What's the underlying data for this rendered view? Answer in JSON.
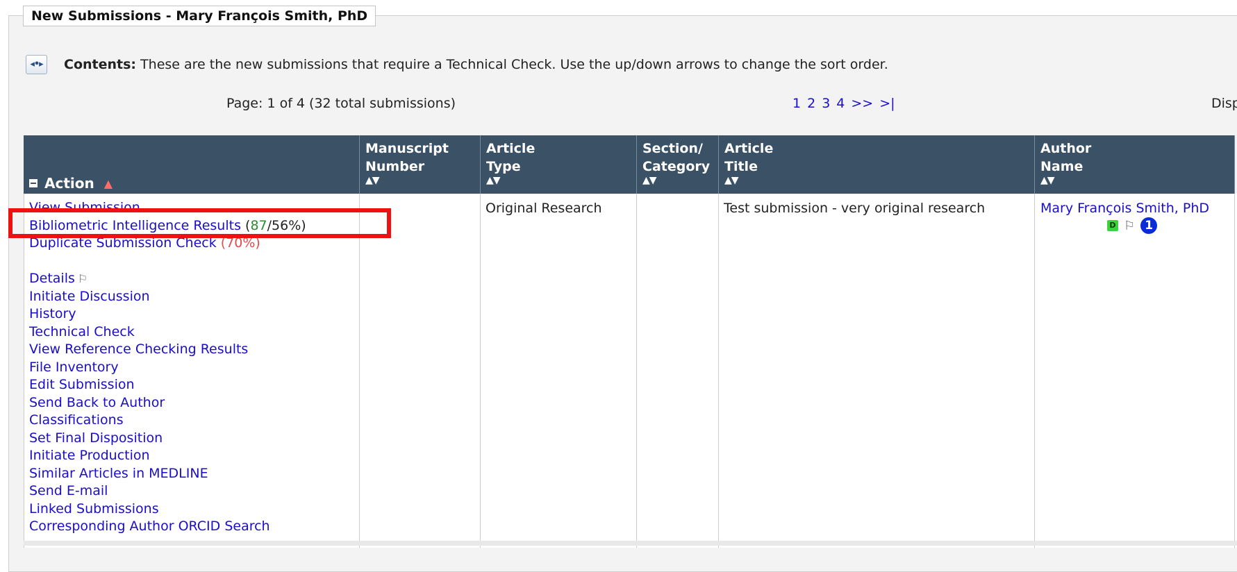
{
  "panel": {
    "title": "New Submissions - Mary François Smith, PhD"
  },
  "contents": {
    "label": "Contents:",
    "text": " These are the new submissions that require a Technical Check. Use the up/down arrows to change the sort order."
  },
  "paging": {
    "info": "Page: 1 of 4 (32 total submissions)",
    "pages": [
      "1",
      "2",
      "3",
      "4",
      ">>",
      ">|"
    ],
    "display_cut": "Disp"
  },
  "columns": {
    "action": "Action",
    "manuscript_number": [
      "Manuscript",
      "Number"
    ],
    "article_type": [
      "Article",
      "Type"
    ],
    "section_category": [
      "Section/",
      "Category"
    ],
    "article_title": [
      "Article",
      "Title"
    ],
    "author_name": [
      "Author",
      "Name"
    ]
  },
  "row": {
    "actions": {
      "view_submission": "View Submission",
      "bibliometric": "Bibliometric Intelligence Results",
      "bibliometric_open": " (",
      "bibliometric_score_green": "87",
      "bibliometric_score_rest": "/56%)",
      "duplicate": "Duplicate Submission Check",
      "duplicate_score": " (70%)",
      "details": "Details",
      "initiate_discussion": "Initiate Discussion",
      "history": "History",
      "technical_check": "Technical Check",
      "view_reference": "View Reference Checking Results",
      "file_inventory": "File Inventory",
      "edit_submission": "Edit Submission",
      "send_back": "Send Back to Author",
      "classifications": "Classifications",
      "set_final": "Set Final Disposition",
      "initiate_production": "Initiate Production",
      "similar_articles": "Similar Articles in MEDLINE",
      "send_email": "Send E-mail",
      "linked_submissions": "Linked Submissions",
      "orcid_search": "Corresponding Author ORCID Search"
    },
    "manuscript_number": "",
    "article_type": "Original Research",
    "section_category": "",
    "article_title": "Test submission - very original research",
    "author_name": "Mary François Smith, PhD",
    "author_badge": "D",
    "author_count": "1"
  },
  "colors": {
    "header_bg": "#3a5166",
    "link": "#1a0dcc",
    "highlight_border": "#ee1111",
    "score_green": "#2e8b2e",
    "score_red": "#e24b4b"
  },
  "icons": {
    "contents": "expand-collapse-arrows-icon",
    "sort": "sort-up-down-icon",
    "flag": "flag-icon",
    "collapse": "minus-box-icon",
    "warning": "warning-triangle-icon"
  }
}
